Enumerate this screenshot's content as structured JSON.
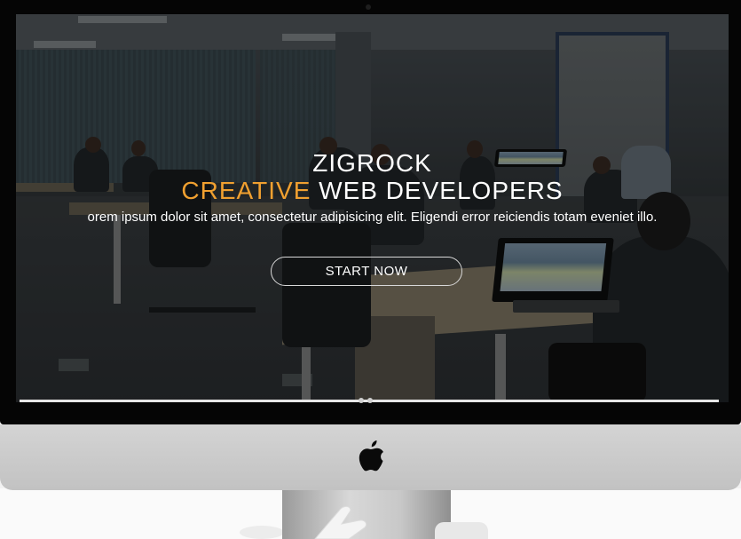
{
  "hero": {
    "title": "ZIGROCK",
    "subtitle_accent": "CREATIVE",
    "subtitle_rest": " WEB DEVELOPERS",
    "description": "orem ipsum dolor sit amet, consectetur adipisicing elit. Eligendi error reiciendis totam eveniet illo.",
    "cta_label": "START NOW"
  },
  "colors": {
    "accent": "#f0a030",
    "text": "#ffffff",
    "bezel": "#050505",
    "chin": "#c8c8c8"
  },
  "icons": {
    "logo": "apple-logo-icon"
  }
}
